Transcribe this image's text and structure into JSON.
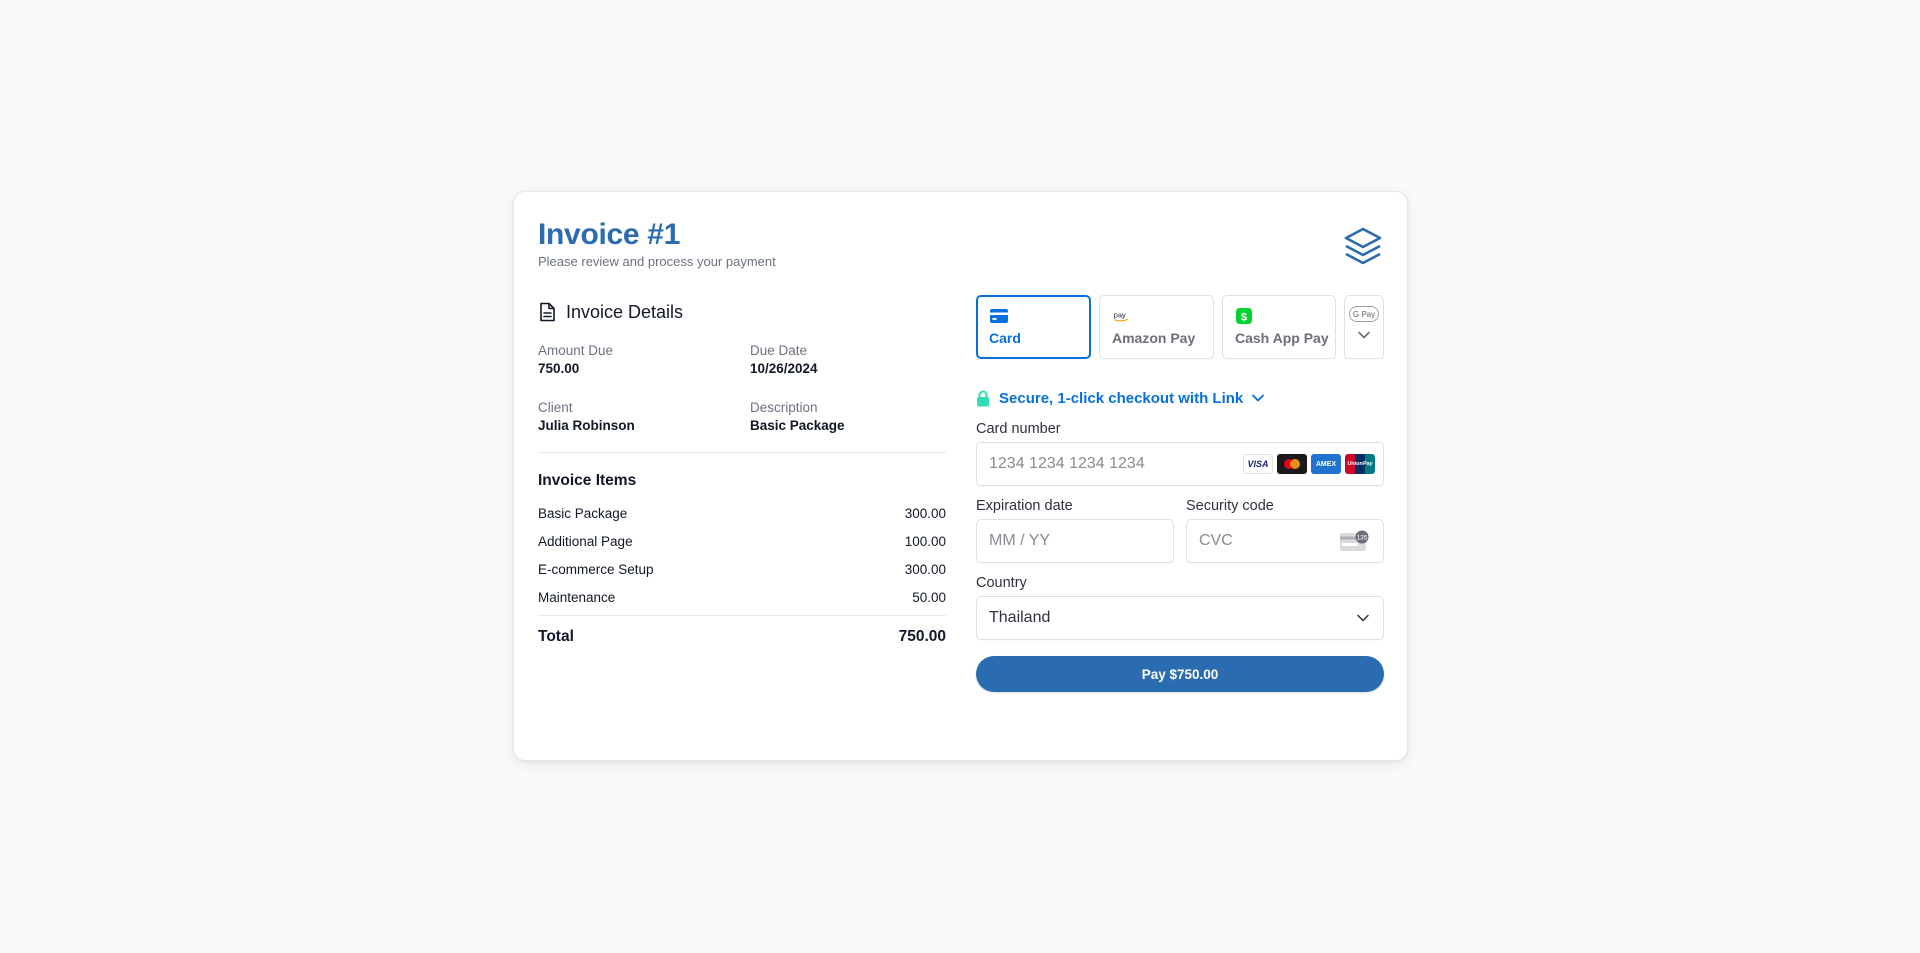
{
  "header": {
    "title": "Invoice #1",
    "subtitle": "Please review and process your payment",
    "logo_icon": "layers-icon"
  },
  "details": {
    "section_title": "Invoice Details",
    "section_icon": "document-icon",
    "fields": [
      {
        "label": "Amount Due",
        "value": "750.00"
      },
      {
        "label": "Due Date",
        "value": "10/26/2024"
      },
      {
        "label": "Client",
        "value": "Julia Robinson"
      },
      {
        "label": "Description",
        "value": "Basic Package"
      }
    ]
  },
  "items": {
    "title": "Invoice Items",
    "rows": [
      {
        "name": "Basic Package",
        "amount": "300.00"
      },
      {
        "name": "Additional Page",
        "amount": "100.00"
      },
      {
        "name": "E-commerce Setup",
        "amount": "300.00"
      },
      {
        "name": "Maintenance",
        "amount": "50.00"
      }
    ],
    "total_label": "Total",
    "total_value": "750.00"
  },
  "payment": {
    "tabs": [
      {
        "label": "Card",
        "icon": "credit-card-icon",
        "active": true
      },
      {
        "label": "Amazon Pay",
        "icon": "amazon-pay-icon",
        "active": false
      },
      {
        "label": "Cash App Pay",
        "icon": "cash-app-icon",
        "active": false
      }
    ],
    "more_tab_icon": "google-pay-icon",
    "link_text": "Secure, 1-click checkout with Link",
    "card_number": {
      "label": "Card number",
      "placeholder": "1234 1234 1234 1234"
    },
    "card_brands": [
      "VISA",
      "mastercard",
      "AMEX",
      "UnionPay"
    ],
    "expiration": {
      "label": "Expiration date",
      "placeholder": "MM / YY"
    },
    "security": {
      "label": "Security code",
      "placeholder": "CVC",
      "hint_text": "135"
    },
    "country": {
      "label": "Country",
      "value": "Thailand"
    },
    "pay_button": "Pay $750.00"
  },
  "colors": {
    "brand": "#2b6cb0",
    "stripe_blue": "#0570de",
    "link_green": "#33ddb3",
    "background": "#f9fafb"
  }
}
